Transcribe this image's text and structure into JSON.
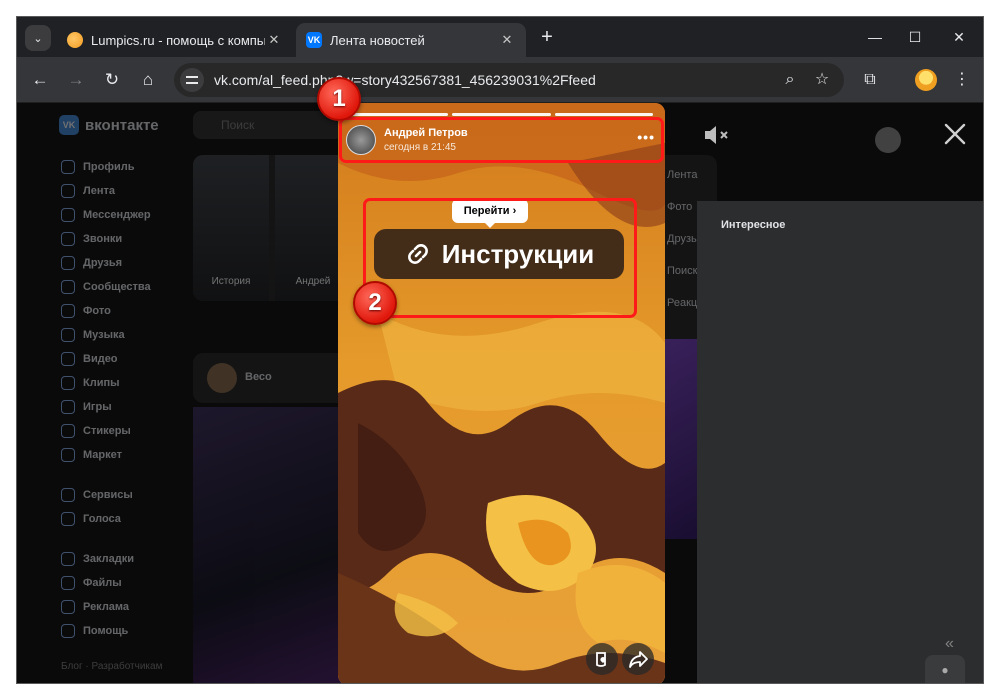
{
  "browser": {
    "tabs": [
      {
        "title": "Lumpics.ru - помощь с компьютером",
        "active": false
      },
      {
        "title": "Лента новостей",
        "active": true
      }
    ],
    "url": "vk.com/al_feed.php?w=story432567381_456239031%2Ffeed"
  },
  "vk": {
    "logo": "вконтакте",
    "search_placeholder": "Поиск",
    "nav": [
      "Профиль",
      "Лента",
      "Мессенджер",
      "Звонки",
      "Друзья",
      "Сообщества",
      "Фото",
      "Музыка",
      "Видео",
      "Клипы",
      "Игры",
      "Стикеры",
      "Маркет"
    ],
    "nav2": [
      "Сервисы",
      "Голоса"
    ],
    "nav3": [
      "Закладки",
      "Файлы",
      "Реклама",
      "Помощь"
    ],
    "footer": "Блог · Разработчикам",
    "stories": [
      "История",
      "Андрей"
    ],
    "post_author": "Весо",
    "filters": [
      "Лента",
      "Фото",
      "Друзья",
      "Поиск",
      "Реакции"
    ],
    "right_heading": "Интересное"
  },
  "story": {
    "author": "Андрей Петров",
    "time": "сегодня в 21:45",
    "progress_segments": 3,
    "link_tip": "Перейти ›",
    "link_text": "Инструкции"
  },
  "annotations": [
    {
      "label": "1"
    },
    {
      "label": "2"
    }
  ]
}
